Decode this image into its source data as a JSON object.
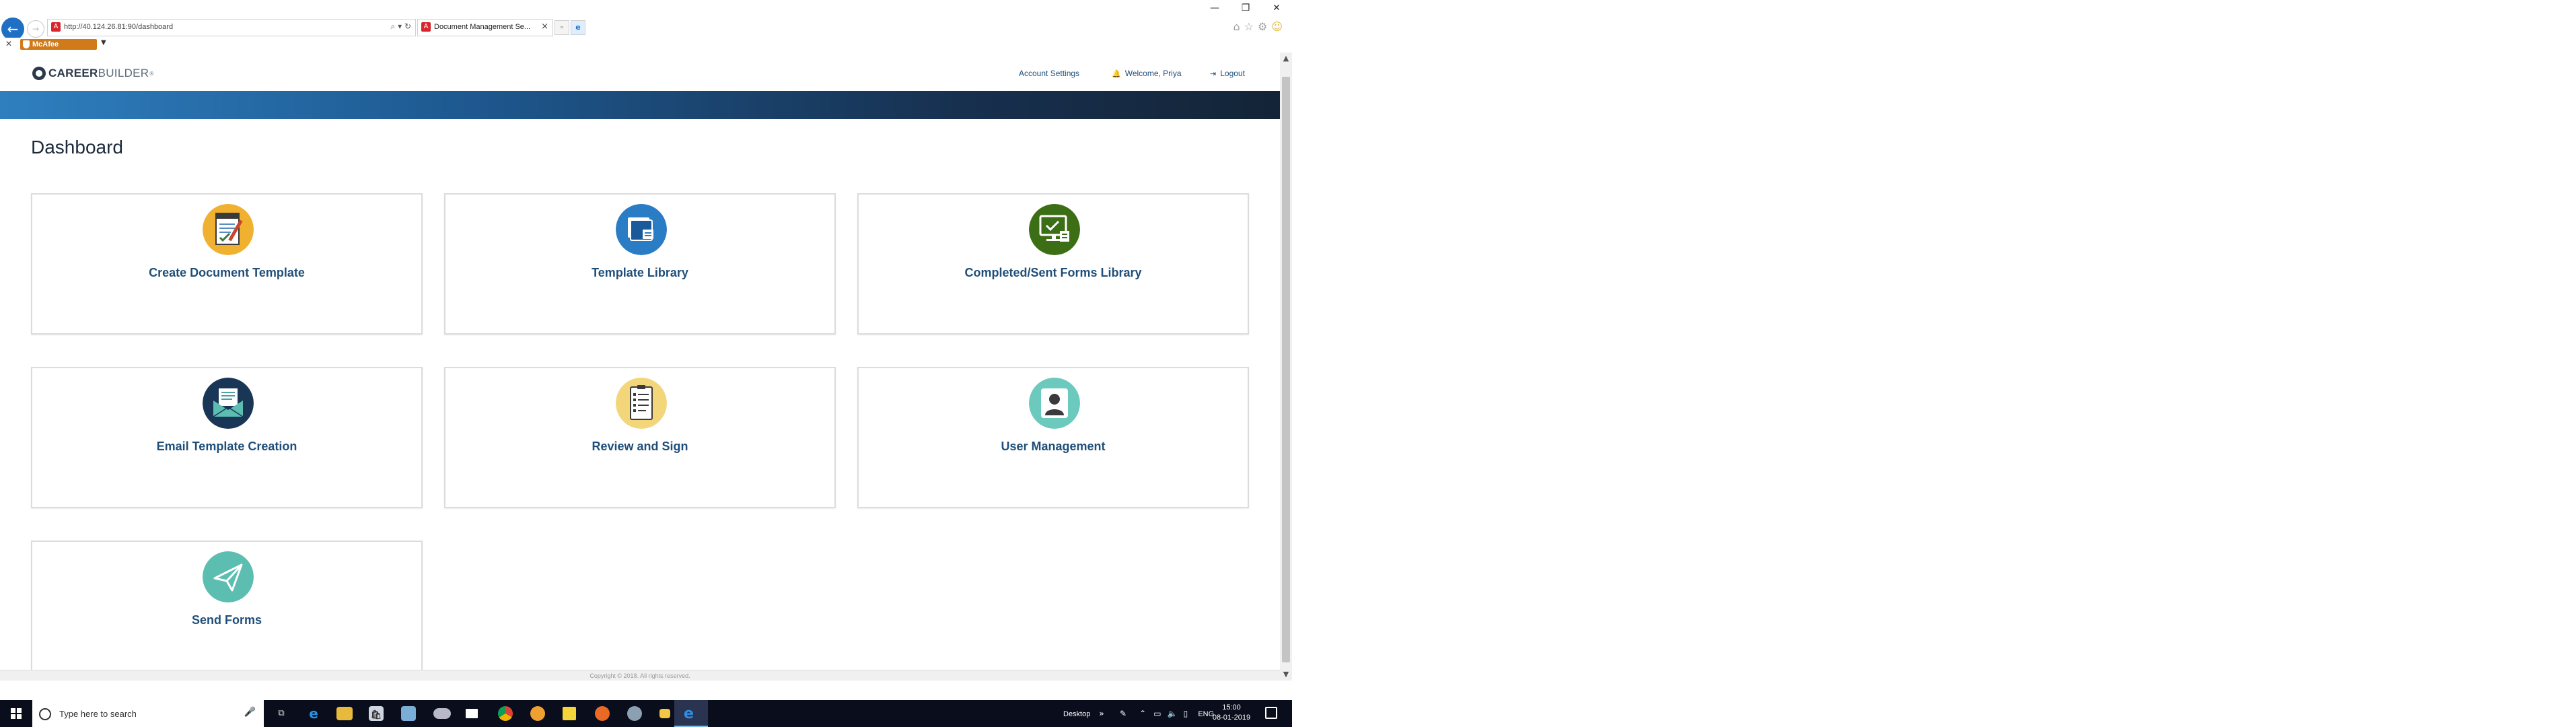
{
  "browser": {
    "url": "http://40.124.26.81:90/dashboard",
    "tab_title": "Document Management Se...",
    "toolbar_addon": "McAfee",
    "window_controls": {
      "minimize": "—",
      "restore": "❐",
      "close": "✕"
    },
    "icons": [
      "back-arrow-icon",
      "forward-arrow-icon",
      "search-icon",
      "refresh-icon",
      "home-icon",
      "favorites-star-icon",
      "settings-gear-icon",
      "smiley-icon"
    ]
  },
  "header": {
    "logo_bold": "CAREER",
    "logo_light": "BUILDER",
    "logo_reg": "®",
    "account_settings": "Account Settings",
    "welcome": "Welcome, Priya",
    "logout": "Logout"
  },
  "main": {
    "title": "Dashboard",
    "cards": [
      {
        "label": "Create Document Template",
        "icon": "document-template-icon",
        "color": "#f0b030"
      },
      {
        "label": "Template Library",
        "icon": "library-folder-icon",
        "color": "#2a7dc4"
      },
      {
        "label": "Completed/Sent Forms Library",
        "icon": "completed-forms-icon",
        "color": "#3c6e16"
      },
      {
        "label": "Email Template Creation",
        "icon": "email-template-icon",
        "color": "#1a3656"
      },
      {
        "label": "Review and Sign",
        "icon": "review-sign-icon",
        "color": "#f3d67a"
      },
      {
        "label": "User Management",
        "icon": "user-icon",
        "color": "#6cc9be"
      },
      {
        "label": "Send Forms",
        "icon": "send-paper-plane-icon",
        "color": "#5cbeb1"
      }
    ]
  },
  "footer": {
    "text": "Copyright © 2018. All rights reserved."
  },
  "taskbar": {
    "search_placeholder": "Type here to search",
    "desktop_label": "Desktop",
    "language": "ENG",
    "time": "15:00",
    "date": "08-01-2019"
  },
  "colors": {
    "accent": "#1e4e79",
    "banner_start": "#2f7fbf",
    "banner_end": "#142437"
  }
}
